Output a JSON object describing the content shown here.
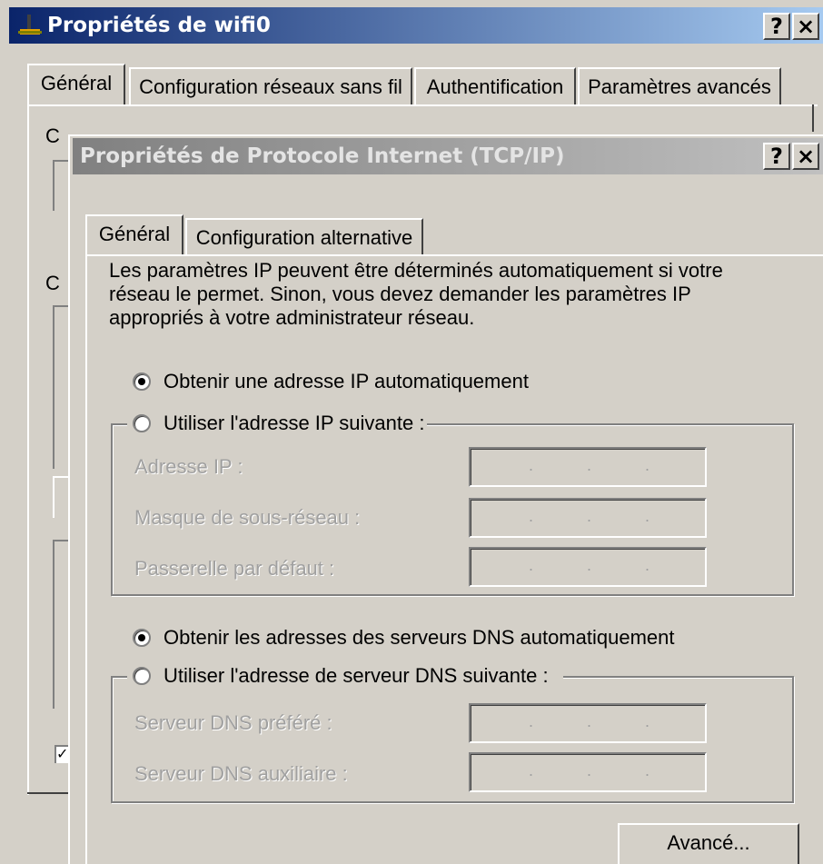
{
  "outer_window": {
    "title": "Propriétés de wifi0",
    "help_button": "?",
    "close_button": "×",
    "tabs": [
      "Général",
      "Configuration réseaux sans fil",
      "Authentification",
      "Paramètres avancés"
    ],
    "partial_labels": [
      "C",
      "C"
    ],
    "checkbox_checked": true
  },
  "dialog": {
    "title": "Propriétés de Protocole Internet (TCP/IP)",
    "help_button": "?",
    "close_button": "×",
    "tabs": [
      "Général",
      "Configuration alternative"
    ],
    "description": [
      "Les paramètres IP peuvent être déterminés automatiquement si votre",
      "réseau le permet. Sinon, vous devez demander les paramètres IP",
      "appropriés à votre administrateur réseau."
    ],
    "ip": {
      "auto_label": "Obtenir une adresse IP automatiquement",
      "manual_label": "Utiliser l'adresse IP suivante :",
      "selected": "auto",
      "fields": [
        {
          "label": "Adresse IP :",
          "value": ""
        },
        {
          "label": "Masque de sous-réseau :",
          "value": ""
        },
        {
          "label": "Passerelle par défaut :",
          "value": ""
        }
      ]
    },
    "dns": {
      "auto_label": "Obtenir les adresses des serveurs DNS automatiquement",
      "manual_label": "Utiliser l'adresse de serveur DNS suivante :",
      "selected": "auto",
      "fields": [
        {
          "label": "Serveur DNS préféré :",
          "value": ""
        },
        {
          "label": "Serveur DNS auxiliaire :",
          "value": ""
        }
      ]
    },
    "advanced_button": "Avancé..."
  }
}
